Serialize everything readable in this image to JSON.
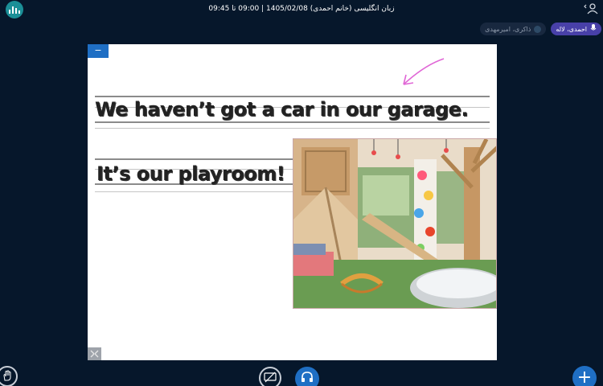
{
  "header": {
    "title": "زبان انگلیسی (خانم احمدی) 1405/02/08 | 09:00 تا 09:45",
    "stats_icon": "bar-chart-icon",
    "user_icon": "user-menu-icon"
  },
  "participants": [
    {
      "label": "احمدی، لاله",
      "status": "presenter",
      "icon": "mic-icon",
      "color": "#4840a8"
    },
    {
      "label": "ذاکری، امیرمهدی",
      "status": "viewer",
      "color": "#18283f"
    }
  ],
  "slide": {
    "minimize_label": "−",
    "line1": "We haven’t got a car in our garage.",
    "line2": "It’s our playroom!",
    "arrow_color": "#e066d6",
    "photo_description_icon": "playroom-photo"
  },
  "controls": {
    "raise_hand_icon": "hand-icon",
    "screen_share_icon": "screen-share-off-icon",
    "audio_icon": "headphones-icon",
    "add_label": "+",
    "accent": "#1f6fc4"
  }
}
